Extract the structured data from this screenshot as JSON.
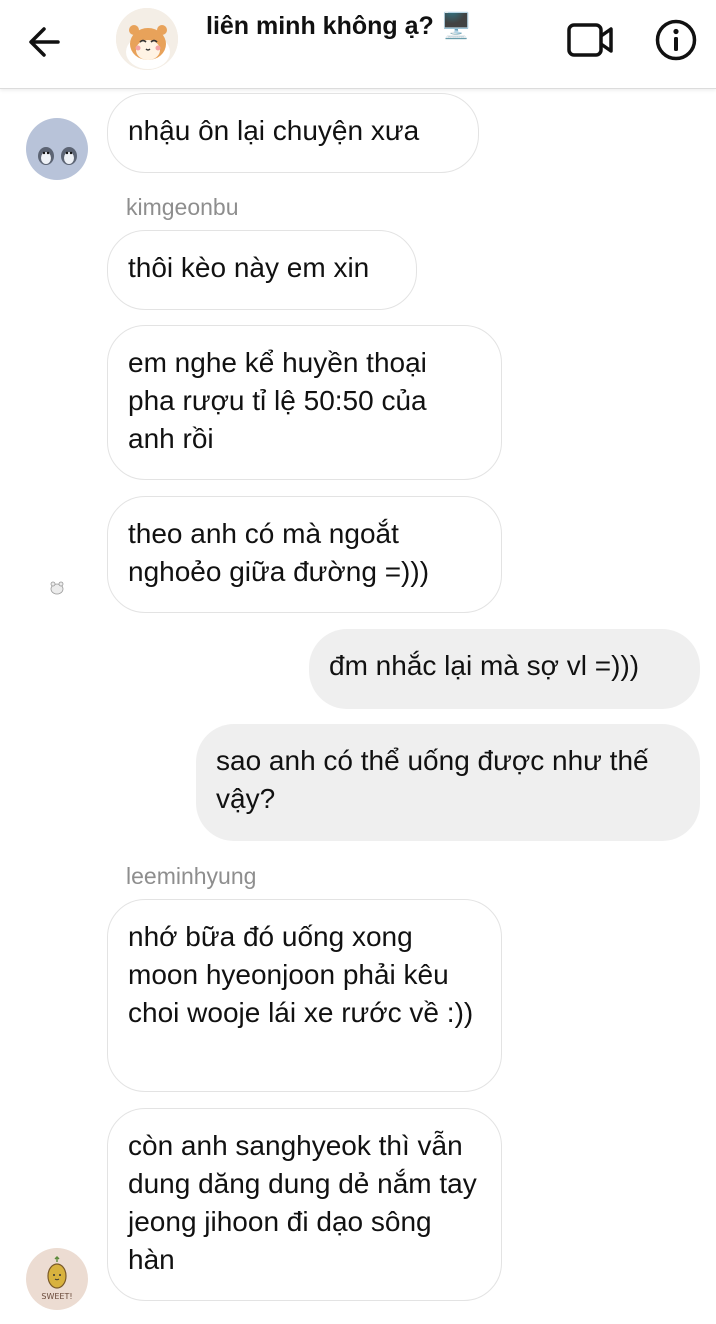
{
  "header": {
    "title": "liên minh không ạ? 🖥️",
    "back_icon": "arrow-left-icon",
    "video_icon": "video-camera-icon",
    "info_icon": "info-icon"
  },
  "messages": [
    {
      "direction": "in",
      "text": "nhậu ôn lại chuyện xưa"
    },
    {
      "direction": "in",
      "sender": "kimgeonbu",
      "text": "thôi kèo này em xin"
    },
    {
      "direction": "in",
      "text": "em nghe kể huyền thoại pha rượu tỉ lệ 50:50 của anh rồi"
    },
    {
      "direction": "in",
      "text": "theo anh có mà ngoắt nghoẻo giữa đường =)))"
    },
    {
      "direction": "out",
      "text": "đm nhắc lại mà sợ vl =)))"
    },
    {
      "direction": "out",
      "text": "sao anh có thể uống được như thế vậy?"
    },
    {
      "direction": "in",
      "sender": "leeminhyung",
      "text": "nhớ bữa đó uống xong moon hyeonjoon phải kêu choi wooje lái xe rước về :))"
    },
    {
      "direction": "in",
      "text": "còn anh sanghyeok thì vẫn dung dăng dung dẻ nắm tay jeong jihoon đi dạo sông hàn"
    }
  ],
  "avatars": {
    "sweet_text": "SWEET!"
  },
  "colors": {
    "incoming_bubble": "#ffffff",
    "outgoing_bubble": "#efefef",
    "sender_name": "#8e8e8e"
  }
}
